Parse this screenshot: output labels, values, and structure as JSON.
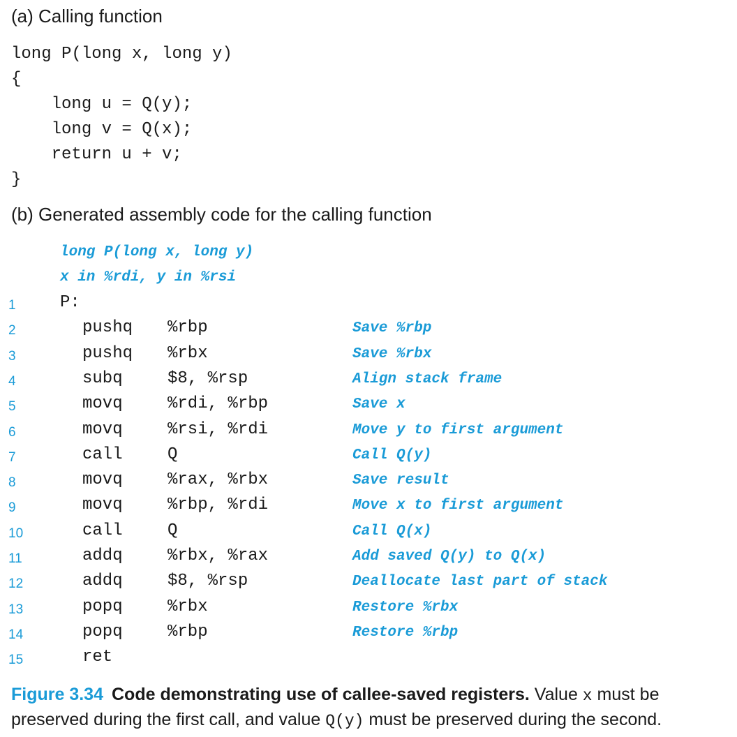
{
  "section_a": {
    "heading": "(a) Calling function",
    "code": [
      "long P(long x, long y)",
      "{",
      "    long u = Q(y);",
      "    long v = Q(x);",
      "    return u + v;",
      "}"
    ]
  },
  "section_b": {
    "heading": "(b) Generated assembly code for the calling function",
    "header_comments": [
      "long P(long x, long y)",
      "x in %rdi, y in %rsi"
    ],
    "lines": [
      {
        "num": "1",
        "label": "P:",
        "op": "",
        "arg": "",
        "comment": ""
      },
      {
        "num": "2",
        "label": "",
        "op": "pushq",
        "arg": "%rbp",
        "comment": "Save %rbp"
      },
      {
        "num": "3",
        "label": "",
        "op": "pushq",
        "arg": "%rbx",
        "comment": "Save %rbx"
      },
      {
        "num": "4",
        "label": "",
        "op": "subq",
        "arg": "$8, %rsp",
        "comment": "Align stack frame"
      },
      {
        "num": "5",
        "label": "",
        "op": "movq",
        "arg": "%rdi, %rbp",
        "comment": "Save x"
      },
      {
        "num": "6",
        "label": "",
        "op": "movq",
        "arg": "%rsi, %rdi",
        "comment": "Move y to first argument"
      },
      {
        "num": "7",
        "label": "",
        "op": "call",
        "arg": "Q",
        "comment": "Call Q(y)"
      },
      {
        "num": "8",
        "label": "",
        "op": "movq",
        "arg": "%rax, %rbx",
        "comment": "Save result"
      },
      {
        "num": "9",
        "label": "",
        "op": "movq",
        "arg": "%rbp, %rdi",
        "comment": "Move x to first argument"
      },
      {
        "num": "10",
        "label": "",
        "op": "call",
        "arg": "Q",
        "comment": "Call Q(x)"
      },
      {
        "num": "11",
        "label": "",
        "op": "addq",
        "arg": "%rbx, %rax",
        "comment": "Add saved Q(y) to Q(x)"
      },
      {
        "num": "12",
        "label": "",
        "op": "addq",
        "arg": "$8, %rsp",
        "comment": "Deallocate last part of stack"
      },
      {
        "num": "13",
        "label": "",
        "op": "popq",
        "arg": "%rbx",
        "comment": "Restore %rbx"
      },
      {
        "num": "14",
        "label": "",
        "op": "popq",
        "arg": "%rbp",
        "comment": "Restore %rbp"
      },
      {
        "num": "15",
        "label": "",
        "op": "ret",
        "arg": "",
        "comment": ""
      }
    ]
  },
  "caption": {
    "figure_number": "Figure 3.34",
    "title": "Code demonstrating use of callee-saved registers.",
    "text_1": "Value ",
    "code_1": "x",
    "text_2": " must be preserved during the first call, and value ",
    "code_2": "Q(y)",
    "text_3": " must be preserved during the second."
  },
  "colors": {
    "accent": "#1a9bd7",
    "text": "#1a1a1a"
  }
}
